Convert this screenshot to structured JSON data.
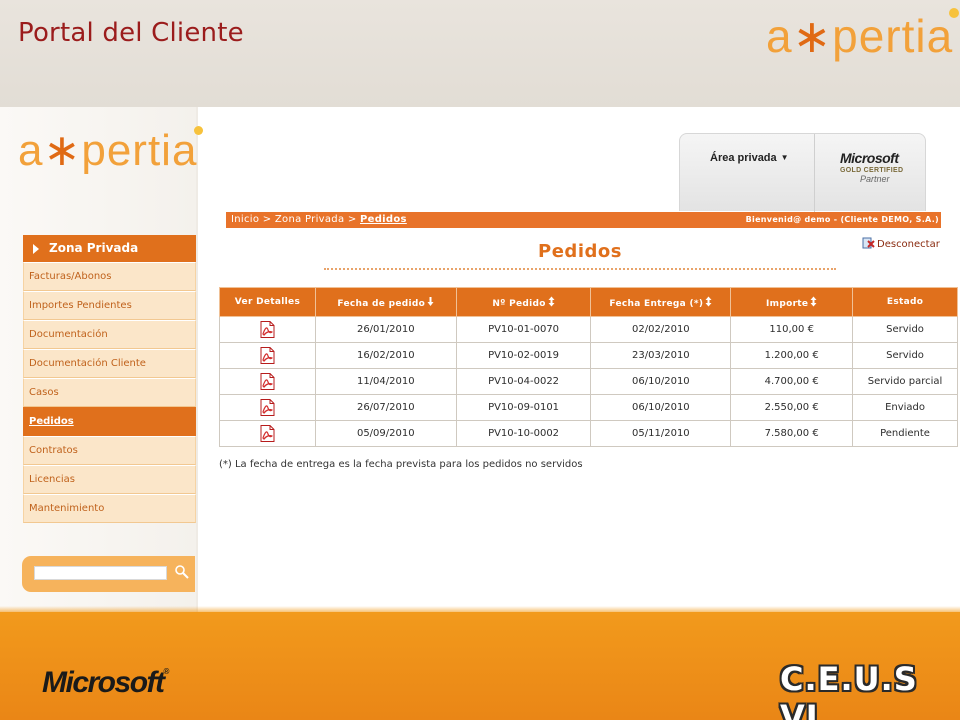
{
  "slide": {
    "title": "Portal del Cliente",
    "footer_brand": "Microsoft",
    "footer_event": "C.E.U.S VI"
  },
  "brand": {
    "logo_text_a": "a",
    "logo_text_ast": "∗",
    "logo_text_rest": "pertia"
  },
  "header": {
    "private_area": "Área privada",
    "partner_brand": "Microsoft",
    "partner_level": "GOLD CERTIFIED",
    "partner_label": "Partner"
  },
  "breadcrumb": {
    "path": "Inicio > Zona Privada > ",
    "current": "Pedidos",
    "welcome": "Bienvenid@ demo - (Cliente DEMO, S.A.)"
  },
  "actions": {
    "disconnect": "Desconectar"
  },
  "page": {
    "heading": "Pedidos",
    "note": "(*) La fecha de entrega es la fecha prevista para los pedidos no servidos"
  },
  "menu": {
    "header": "Zona Privada",
    "items": [
      {
        "label": "Facturas/Abonos"
      },
      {
        "label": "Importes Pendientes"
      },
      {
        "label": "Documentación"
      },
      {
        "label": "Documentación Cliente"
      },
      {
        "label": "Casos"
      },
      {
        "label": "Pedidos"
      },
      {
        "label": "Contratos"
      },
      {
        "label": "Licencias"
      },
      {
        "label": "Mantenimiento"
      }
    ],
    "active_index": 5
  },
  "search": {
    "placeholder": ""
  },
  "table": {
    "columns": [
      "Ver Detalles",
      "Fecha de pedido",
      "Nº Pedido",
      "Fecha Entrega (*)",
      "Importe",
      "Estado"
    ],
    "rows": [
      [
        "26/01/2010",
        "PV10-01-0070",
        "02/02/2010",
        "110,00 €",
        "Servido"
      ],
      [
        "16/02/2010",
        "PV10-02-0019",
        "23/03/2010",
        "1.200,00 €",
        "Servido"
      ],
      [
        "11/04/2010",
        "PV10-04-0022",
        "06/10/2010",
        "4.700,00 €",
        "Servido parcial"
      ],
      [
        "26/07/2010",
        "PV10-09-0101",
        "06/10/2010",
        "2.550,00 €",
        "Enviado"
      ],
      [
        "05/09/2010",
        "PV10-10-0002",
        "05/11/2010",
        "7.580,00 €",
        "Pendiente"
      ]
    ]
  },
  "colors": {
    "accent": "#e0701c",
    "menu_bg": "#fbe6c9",
    "title": "#9b1c1c",
    "band": "#f29a1c"
  }
}
